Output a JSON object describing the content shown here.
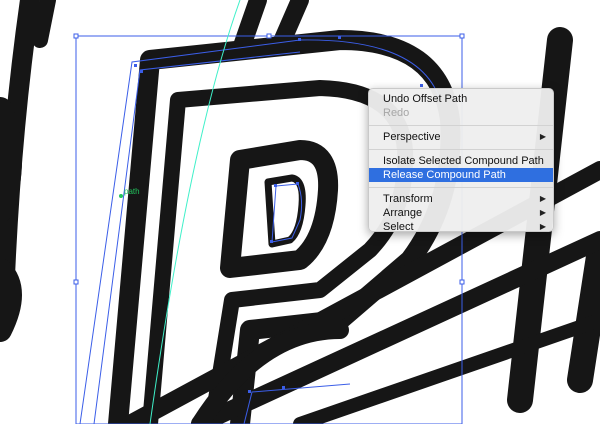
{
  "canvas": {
    "path_label": "path",
    "colors": {
      "stroke": "#161616",
      "selection": "#3b5ee8",
      "guide": "#3ff0c9",
      "label": "#22c55e"
    }
  },
  "context_menu": {
    "items": [
      {
        "label": "Undo Offset Path",
        "enabled": true,
        "submenu": false
      },
      {
        "label": "Redo",
        "enabled": false,
        "submenu": false
      },
      {
        "label": "Perspective",
        "enabled": true,
        "submenu": true
      },
      {
        "label": "Isolate Selected Compound Path",
        "enabled": true,
        "submenu": false
      },
      {
        "label": "Release Compound Path",
        "enabled": true,
        "submenu": false,
        "highlighted": true
      },
      {
        "label": "Transform",
        "enabled": true,
        "submenu": true
      },
      {
        "label": "Arrange",
        "enabled": true,
        "submenu": true
      },
      {
        "label": "Select",
        "enabled": true,
        "submenu": true
      }
    ],
    "highlight_color": "#2f6fe0"
  }
}
